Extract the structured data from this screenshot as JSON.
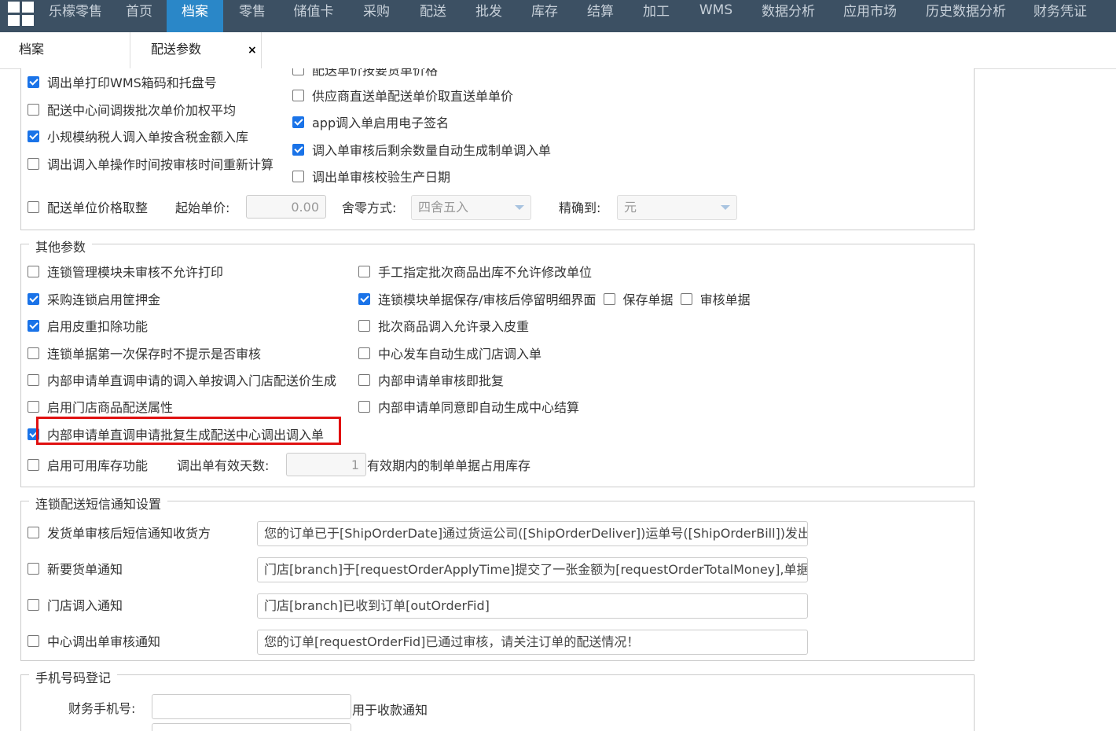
{
  "app": {
    "brand": "乐檬零售"
  },
  "nav": [
    "首页",
    "档案",
    "零售",
    "储值卡",
    "采购",
    "配送",
    "批发",
    "库存",
    "结算",
    "加工",
    "WMS",
    "数据分析",
    "应用市场",
    "历史数据分析",
    "财务凭证"
  ],
  "tabs": [
    "档案",
    "配送参数"
  ],
  "tab_close": "×",
  "distribution": {
    "left": [
      {
        "label": "调出单打印WMS箱码和托盘号",
        "checked": true
      },
      {
        "label": "配送中心间调拨批次单价加权平均",
        "checked": false
      },
      {
        "label": "小规模纳税人调入单按含税金额入库",
        "checked": true
      },
      {
        "label": "调出调入单操作时间按审核时间重新计算",
        "checked": false
      }
    ],
    "right": [
      {
        "label": "配送单价按要货单价格",
        "checked": false
      },
      {
        "label": "供应商直送单配送单价取直送单单价",
        "checked": false
      },
      {
        "label": "app调入单启用电子签名",
        "checked": true
      },
      {
        "label": "调入单审核后剩余数量自动生成制单调入单",
        "checked": true
      },
      {
        "label": "调出单审核校验生产日期",
        "checked": false
      }
    ],
    "price_round": {
      "label": "配送单位价格取整",
      "checked": false,
      "start_price_label": "起始单价:",
      "start_price": "0.00",
      "rounding_label": "舍零方式:",
      "rounding": "四舍五入",
      "precision_label": "精确到:",
      "precision": "元"
    }
  },
  "other": {
    "legend": "其他参数",
    "left": [
      {
        "label": "连锁管理模块未审核不允许打印",
        "checked": false
      },
      {
        "label": "采购连锁启用筐押金",
        "checked": true
      },
      {
        "label": "启用皮重扣除功能",
        "checked": true
      },
      {
        "label": "连锁单据第一次保存时不提示是否审核",
        "checked": false
      },
      {
        "label": "内部申请单直调申请的调入单按调入门店配送价生成",
        "checked": false
      },
      {
        "label": "启用门店商品配送属性",
        "checked": false
      },
      {
        "label": "内部申请单直调申请批复生成配送中心调出调入单",
        "checked": true
      }
    ],
    "right": [
      {
        "label": "手工指定批次商品出库不允许修改单位",
        "checked": false
      },
      {
        "label": "连锁模块单据保存/审核后停留明细界面",
        "checked": true
      },
      {
        "label": "批次商品调入允许录入皮重",
        "checked": false
      },
      {
        "label": "中心发车自动生成门店调入单",
        "checked": false
      },
      {
        "label": "内部申请单审核即批复",
        "checked": false
      },
      {
        "label": "内部申请单同意即自动生成中心结算",
        "checked": false
      }
    ],
    "save_doc": {
      "label": "保存单据",
      "checked": false
    },
    "audit_doc": {
      "label": "审核单据",
      "checked": false
    },
    "stock": {
      "label": "启用可用库存功能",
      "checked": false,
      "days_label": "调出单有效天数:",
      "days": "1",
      "suffix": "有效期内的制单单据占用库存"
    }
  },
  "sms": {
    "legend": "连锁配送短信通知设置",
    "items": [
      {
        "label": "发货单审核后短信通知收货方",
        "checked": false,
        "text": "您的订单已于[ShipOrderDate]通过货运公司([ShipOrderDeliver])运单号([ShipOrderBill])发出，请"
      },
      {
        "label": "新要货单通知",
        "checked": false,
        "text": "门店[branch]于[requestOrderApplyTime]提交了一张金额为[requestOrderTotalMoney],单据号为"
      },
      {
        "label": "门店调入通知",
        "checked": false,
        "text": "门店[branch]已收到订单[outOrderFid]"
      },
      {
        "label": "中心调出单审核通知",
        "checked": false,
        "text": "您的订单[requestOrderFid]已通过审核，请关注订单的配送情况！"
      }
    ]
  },
  "phone": {
    "legend": "手机号码登记",
    "finance_label": "财务手机号:",
    "finance_value": "",
    "finance_hint": "用于收款通知"
  },
  "colors": {
    "topbar": "#3c5063",
    "active_nav": "#2a87c8",
    "checkbox": "#1a73e8",
    "highlight": "#e01010"
  }
}
